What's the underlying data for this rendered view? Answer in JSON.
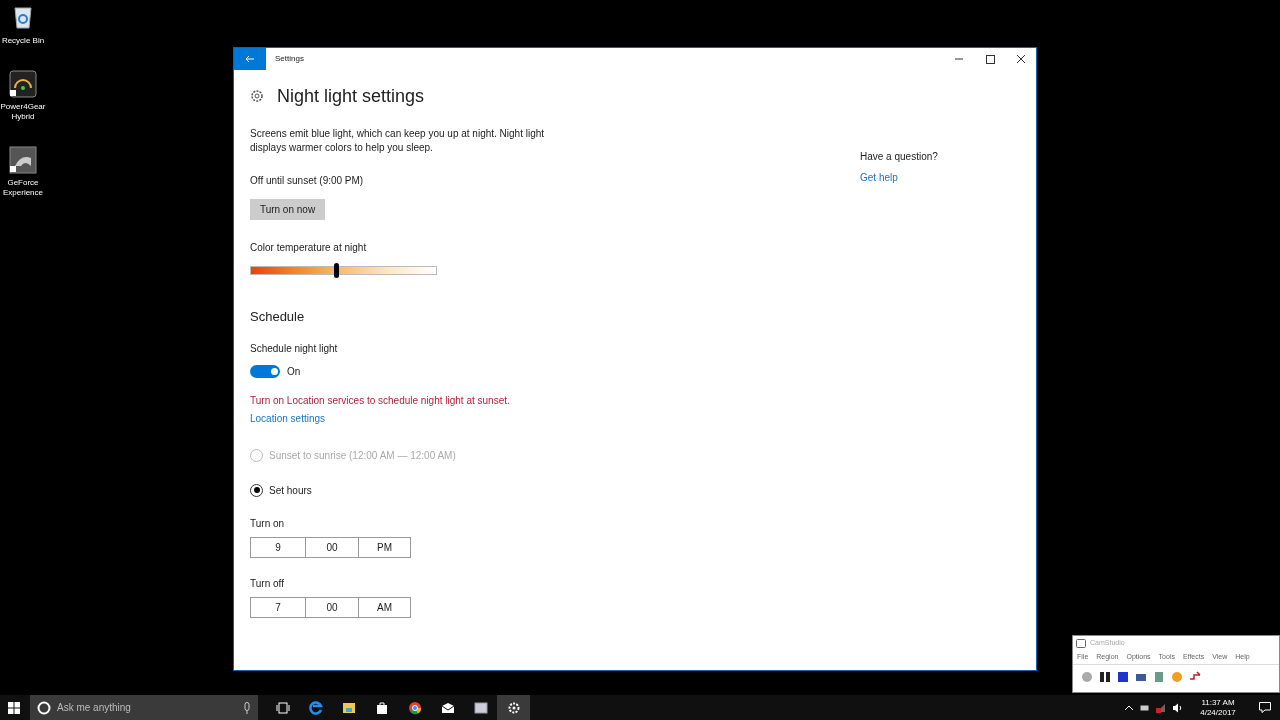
{
  "desktop_icons": [
    {
      "label": "Recycle Bin",
      "kind": "bin"
    },
    {
      "label": "Power4Gear Hybrid",
      "kind": "gauge"
    },
    {
      "label": "GeForce Experience",
      "kind": "nvidia"
    }
  ],
  "settings_window": {
    "title": "Settings",
    "heading": "Night light settings",
    "description": "Screens emit blue light, which can keep you up at night. Night light displays warmer colors to help you sleep.",
    "status": "Off until sunset (9:00 PM)",
    "turn_on_button": "Turn on now",
    "color_temperature": {
      "label": "Color temperature at night",
      "level": 0.46
    },
    "schedule": {
      "heading": "Schedule",
      "toggle": {
        "label": "Schedule night light",
        "on": true,
        "state_text": "On"
      },
      "warning": "Turn on Location services to schedule night light at sunset.",
      "location_link": "Location settings",
      "options": [
        {
          "label": "Sunset to sunrise (12:00 AM — 12:00 AM)",
          "selected": false,
          "disabled": true
        },
        {
          "label": "Set hours",
          "selected": true,
          "disabled": false
        }
      ],
      "times": [
        {
          "label": "Turn on",
          "hour": "9",
          "minute": "00",
          "period": "PM"
        },
        {
          "label": "Turn off",
          "hour": "7",
          "minute": "00",
          "period": "AM"
        }
      ]
    },
    "help": {
      "question": "Have a question?",
      "link": "Get help"
    }
  },
  "camstudio": {
    "title": "CamStudio",
    "menu": [
      "File",
      "Region",
      "Options",
      "Tools",
      "Effects",
      "View",
      "Help"
    ]
  },
  "taskbar": {
    "search_placeholder": "Ask me anything",
    "time": "11:37 AM",
    "date": "4/24/2017"
  }
}
